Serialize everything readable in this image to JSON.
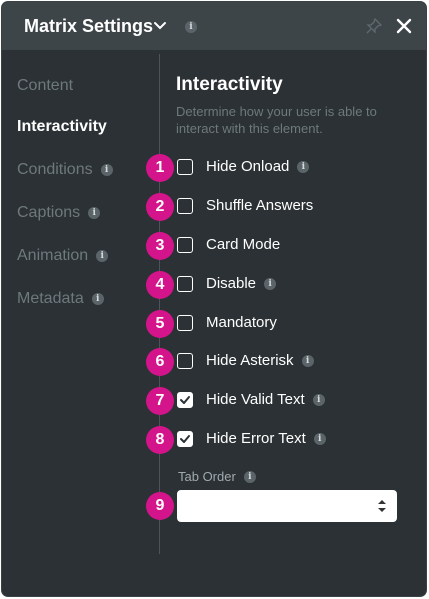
{
  "header": {
    "title": "Matrix Settings",
    "info_icon": "info-icon"
  },
  "sidebar": {
    "items": [
      {
        "label": "Content",
        "active": false,
        "info": false
      },
      {
        "label": "Interactivity",
        "active": true,
        "info": false
      },
      {
        "label": "Conditions",
        "active": false,
        "info": true
      },
      {
        "label": "Captions",
        "active": false,
        "info": true
      },
      {
        "label": "Animation",
        "active": false,
        "info": true
      },
      {
        "label": "Metadata",
        "active": false,
        "info": true
      }
    ]
  },
  "interactivity": {
    "title": "Interactivity",
    "description": "Determine how your user is able to interact with this element.",
    "options": [
      {
        "badge": "1",
        "label": "Hide Onload",
        "checked": false,
        "info": true
      },
      {
        "badge": "2",
        "label": "Shuffle Answers",
        "checked": false,
        "info": false
      },
      {
        "badge": "3",
        "label": "Card Mode",
        "checked": false,
        "info": false
      },
      {
        "badge": "4",
        "label": "Disable",
        "checked": false,
        "info": true
      },
      {
        "badge": "5",
        "label": "Mandatory",
        "checked": false,
        "info": false
      },
      {
        "badge": "6",
        "label": "Hide Asterisk",
        "checked": false,
        "info": true
      },
      {
        "badge": "7",
        "label": "Hide Valid Text",
        "checked": true,
        "info": true
      },
      {
        "badge": "8",
        "label": "Hide Error Text",
        "checked": true,
        "info": true
      }
    ],
    "tab_order": {
      "badge": "9",
      "label": "Tab Order",
      "value": ""
    }
  },
  "colors": {
    "panel_bg": "#2b3134",
    "header_bg": "#3d4549",
    "badge": "#d4148a",
    "muted_text": "#6e797d"
  }
}
